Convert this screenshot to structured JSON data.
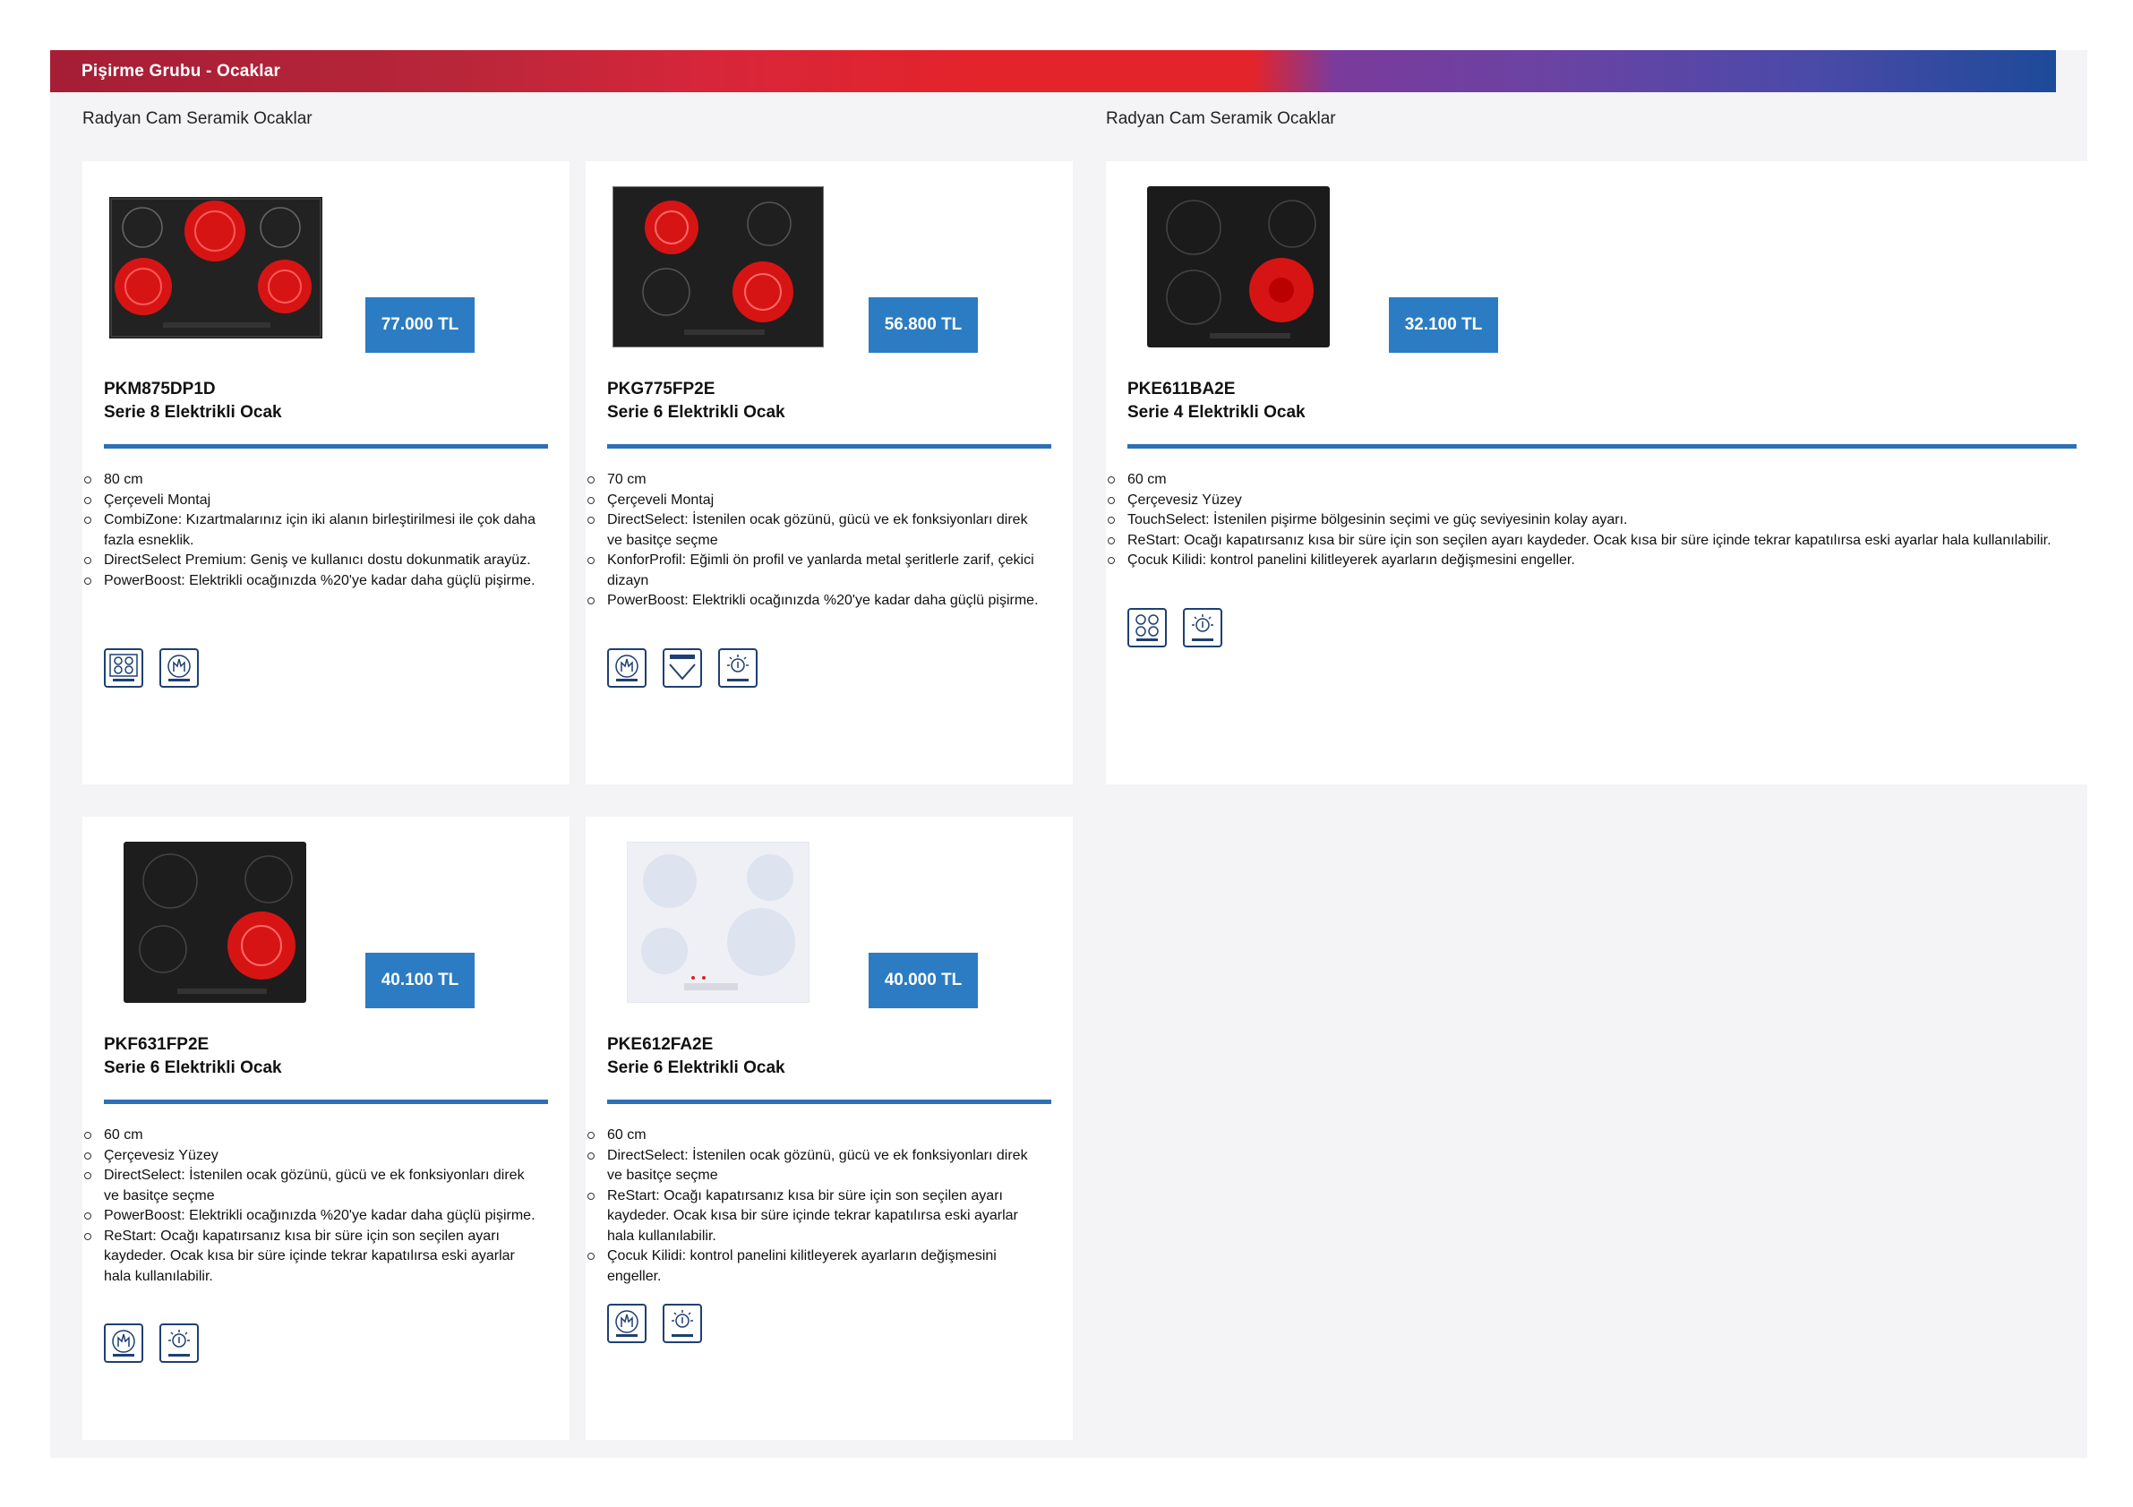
{
  "header": {
    "title": "Pişirme Grubu - Ocaklar"
  },
  "sections": [
    {
      "title": "Radyan Cam Seramik Ocaklar"
    },
    {
      "title": "Radyan Cam Seramik Ocaklar"
    }
  ],
  "colors": {
    "accent": "#2b7cc3",
    "rule": "#2f6fb5",
    "icon_border": "#1e3f73"
  },
  "products": [
    {
      "sku": "PKM875DP1D",
      "name": "Serie 8 Elektrikli Ocak",
      "price": "77.000 TL",
      "features": [
        "80 cm",
        "Çerçeveli Montaj",
        "CombiZone: Kızartmalarınız için iki alanın birleştirilmesi ile çok daha fazla esneklik.",
        "DirectSelect Premium: Geniş ve kullanıcı dostu dokunmatik arayüz.",
        "PowerBoost: Elektrikli ocağınızda %20'ye kadar daha güçlü pişirme."
      ],
      "icons": [
        "combizone-icon",
        "directselect-premium-icon"
      ]
    },
    {
      "sku": "PKG775FP2E",
      "name": "Serie 6 Elektrikli Ocak",
      "price": "56.800 TL",
      "features": [
        "70 cm",
        "Çerçeveli Montaj",
        "DirectSelect: İstenilen ocak gözünü, gücü ve ek fonksiyonları direk ve basitçe seçme",
        "KonforProfil: Eğimli ön profil ve yanlarda metal şeritlerle zarif, çekici dizayn",
        "PowerBoost: Elektrikli ocağınızda %20'ye kadar daha güçlü pişirme."
      ],
      "icons": [
        "directselect-icon",
        "comfortprofil-icon",
        "restart-icon"
      ]
    },
    {
      "sku": "PKE611BA2E",
      "name": "Serie 4 Elektrikli Ocak",
      "price": "32.100 TL",
      "features": [
        "60 cm",
        "Çerçevesiz Yüzey",
        "TouchSelect: İstenilen pişirme bölgesinin seçimi ve güç seviyesinin kolay ayarı.",
        "ReStart: Ocağı kapatırsanız kısa bir süre için son seçilen ayarı kaydeder. Ocak kısa bir süre içinde tekrar kapatılırsa eski ayarlar hala kullanılabilir.",
        "Çocuk Kilidi: kontrol panelini kilitleyerek ayarların değişmesini engeller."
      ],
      "icons": [
        "touchselect-icon",
        "restart-icon"
      ]
    },
    {
      "sku": "PKF631FP2E",
      "name": "Serie 6 Elektrikli Ocak",
      "price": "40.100 TL",
      "features": [
        "60 cm",
        "Çerçevesiz Yüzey",
        "DirectSelect: İstenilen ocak gözünü, gücü ve ek fonksiyonları direk ve basitçe seçme",
        "PowerBoost: Elektrikli ocağınızda %20'ye kadar daha güçlü pişirme.",
        "ReStart: Ocağı kapatırsanız kısa bir süre için son seçilen ayarı kaydeder. Ocak kısa bir süre içinde tekrar kapatılırsa eski ayarlar hala kullanılabilir."
      ],
      "icons": [
        "directselect-icon",
        "restart-icon"
      ]
    },
    {
      "sku": "PKE612FA2E",
      "name": "Serie 6 Elektrikli Ocak",
      "price": "40.000 TL",
      "features": [
        "60 cm",
        "DirectSelect: İstenilen ocak gözünü, gücü ve ek fonksiyonları direk ve basitçe seçme",
        "ReStart: Ocağı kapatırsanız kısa bir süre için son seçilen ayarı kaydeder. Ocak kısa bir süre içinde tekrar kapatılırsa eski ayarlar hala kullanılabilir.",
        "Çocuk Kilidi: kontrol panelini kilitleyerek ayarların değişmesini engeller."
      ],
      "icons": [
        "directselect-icon",
        "restart-icon"
      ]
    }
  ]
}
